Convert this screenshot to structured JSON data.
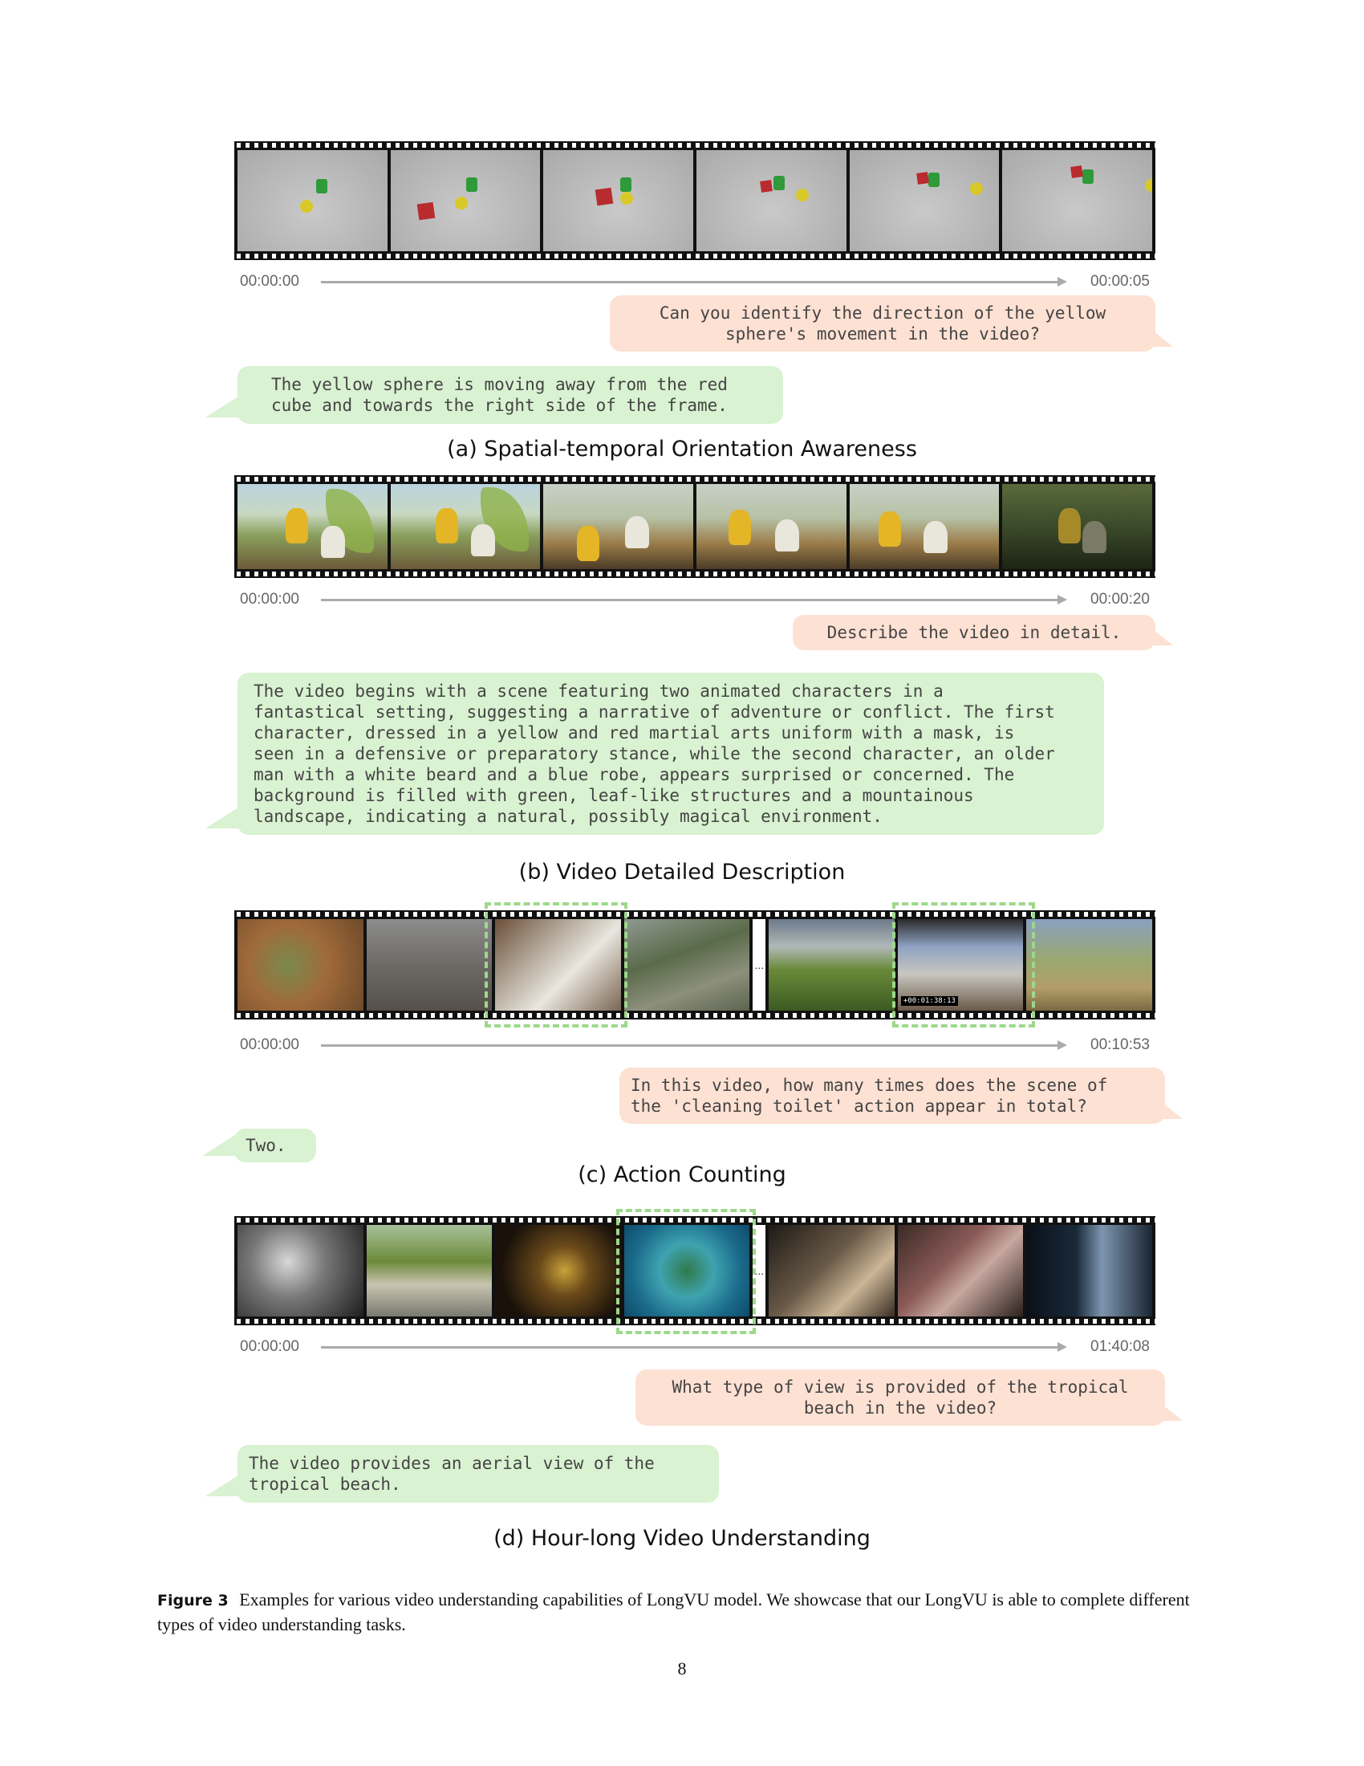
{
  "panels": [
    {
      "time_start": "00:00:00",
      "time_end": "00:00:05",
      "question": "Can you identify the direction of the yellow\nsphere's movement in the video?",
      "answer": "The yellow sphere is moving away from the red\ncube and towards the right side of the frame.",
      "caption": "(a) Spatial-temporal Orientation Awareness"
    },
    {
      "time_start": "00:00:00",
      "time_end": "00:00:20",
      "question": "Describe the video in detail.",
      "answer": "The video begins with a scene featuring two animated characters in a\nfantastical setting, suggesting a narrative of adventure or conflict. The first\ncharacter, dressed in a yellow and red martial arts uniform with a mask, is\nseen in a defensive or preparatory stance, while the second character, an older\nman with a white beard and a blue robe, appears surprised or concerned. The\nbackground is filled with green, leaf-like structures and a mountainous\nlandscape, indicating a natural, possibly magical environment.",
      "caption": "(b) Video Detailed Description"
    },
    {
      "time_start": "00:00:00",
      "time_end": "00:10:53",
      "frame_timestamp": "+00:01:38:13",
      "question": "In this video, how many times does the scene of\nthe 'cleaning toilet' action appear in total?",
      "answer": "Two.",
      "caption": "(c) Action Counting"
    },
    {
      "time_start": "00:00:00",
      "time_end": "01:40:08",
      "question": "What type of view is provided of the tropical\nbeach in the video?",
      "answer": "The video provides an aerial view of the\ntropical beach.",
      "caption": "(d) Hour-long Video Understanding"
    }
  ],
  "gap_symbol": "...",
  "figure": {
    "label": "Figure 3",
    "text": "Examples for various video understanding capabilities of LongVU model. We showcase that our LongVU is able to complete different types of video understanding tasks."
  },
  "page_number": "8",
  "colors": {
    "question_bubble": "#fde1d3",
    "answer_bubble": "#d9f2d1",
    "highlight_dashed": "#9dd88a",
    "timeline": "#aaaaaa"
  }
}
